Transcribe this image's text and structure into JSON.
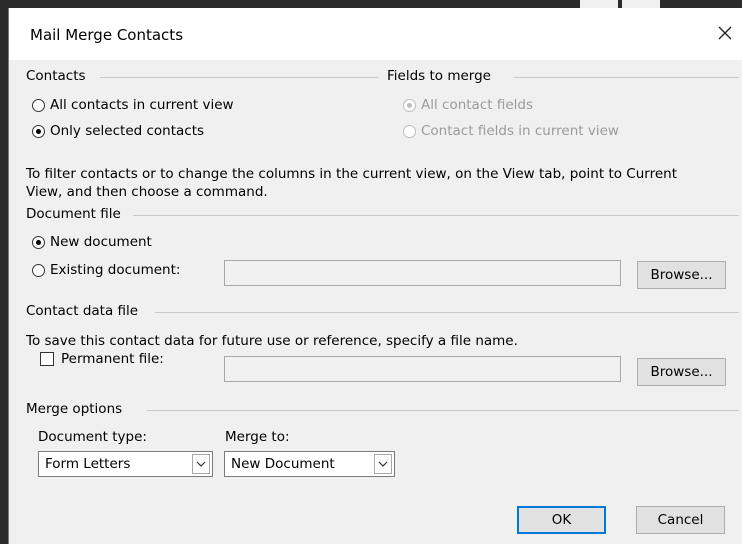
{
  "dialog": {
    "title": "Mail Merge Contacts",
    "close_icon": "close-icon"
  },
  "contacts": {
    "heading": "Contacts",
    "options": [
      {
        "label": "All contacts in current view",
        "checked": false
      },
      {
        "label": "Only selected contacts",
        "checked": true
      }
    ]
  },
  "fields_to_merge": {
    "heading": "Fields to merge",
    "options": [
      {
        "label": "All contact fields",
        "checked": true,
        "disabled": true
      },
      {
        "label": "Contact fields in current view",
        "checked": false,
        "disabled": true
      }
    ]
  },
  "filter_note": {
    "line1": "To filter contacts or to change the columns in the current view, on the View tab, point to Current",
    "line2": "View, and then choose a command."
  },
  "document_file": {
    "heading": "Document file",
    "new_label": "New document",
    "existing_label": "Existing document:",
    "selected": "new",
    "path_value": "",
    "browse_label": "Browse..."
  },
  "contact_data_file": {
    "heading": "Contact data file",
    "note": "To save this contact data for future use or reference, specify a file name.",
    "permanent_label": "Permanent file:",
    "permanent_checked": false,
    "path_value": "",
    "browse_label": "Browse..."
  },
  "merge_options": {
    "heading": "Merge options",
    "document_type_label": "Document type:",
    "document_type_value": "Form Letters",
    "merge_to_label": "Merge to:",
    "merge_to_value": "New Document"
  },
  "buttons": {
    "ok": "OK",
    "cancel": "Cancel"
  },
  "colors": {
    "dialog_bg": "#f0f0f0",
    "titlebar_bg": "#ffffff",
    "default_button_border": "#0078d7",
    "disabled_text": "#9b9b9b"
  }
}
